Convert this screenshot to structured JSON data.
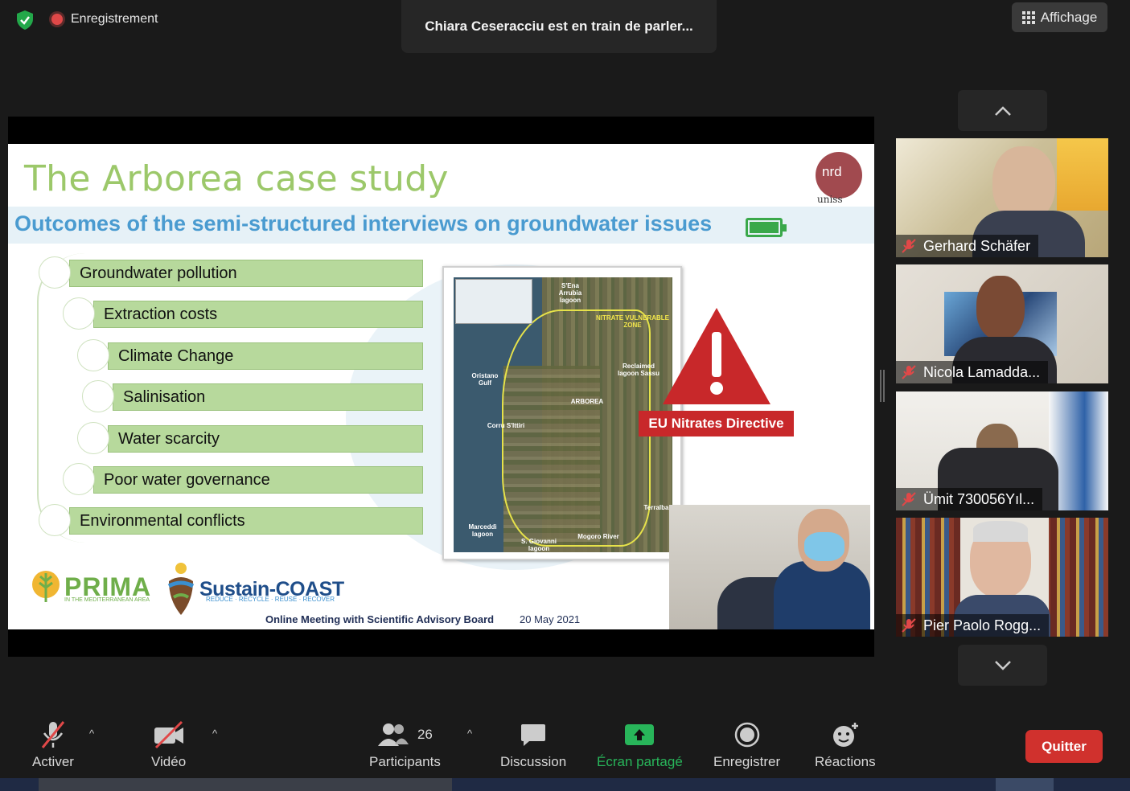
{
  "top_bar": {
    "recording_label": "Enregistrement",
    "speaking_banner": "Chiara Ceseracciu est en train de parler...",
    "view_button": "Affichage"
  },
  "slide": {
    "title": "The Arborea case study",
    "subtitle": "Outcomes of the semi-structured interviews on groundwater issues",
    "logo_nrd": "nrd",
    "logo_uniss": "uniss",
    "items": [
      "Groundwater pollution",
      "Extraction costs",
      "Climate Change",
      "Salinisation",
      "Water scarcity",
      "Poor water governance",
      "Environmental conflicts"
    ],
    "map_labels": {
      "s_ena": "S'Ena Arrubia lagoon",
      "nvz": "NITRATE VULNERABLE ZONE",
      "oristano": "Oristano Gulf",
      "reclaimed": "Reclaimed lagoon Sassu",
      "arborea": "ARBOREA",
      "corru": "Corru S'Ittiri",
      "terralba": "Terralba",
      "marceddi": "Marceddì lagoon",
      "giovanni": "S. Giovanni lagoon",
      "mogoro": "Mogoro River"
    },
    "warning_label": "EU Nitrates Directive",
    "logo_prima": "PRIMA",
    "logo_prima_sub": "IN THE MEDITERRANEAN AREA",
    "logo_sustain": "Sustain-COAST",
    "logo_sustain_sub": "REDUCE · RECYCLE · REUSE · RECOVER",
    "footer_meeting": "Online Meeting with Scientific Advisory Board",
    "footer_date": "20 May 2021",
    "brand_green": "#9cc86a",
    "brand_blue": "#4a9bd0",
    "warning_red": "#c8282a"
  },
  "participants_panel": {
    "tiles": [
      {
        "name": "Gerhard Schäfer",
        "muted": true
      },
      {
        "name": "Nicola Lamadda...",
        "muted": true
      },
      {
        "name": "Ümit 730056Yıl...",
        "muted": true
      },
      {
        "name": "Pier Paolo Rogg...",
        "muted": true
      }
    ]
  },
  "toolbar": {
    "mic_label": "Activer",
    "video_label": "Vidéo",
    "participants_count": "26",
    "participants_label": "Participants",
    "chat_label": "Discussion",
    "share_label": "Écran partagé",
    "record_label": "Enregistrer",
    "reactions_label": "Réactions",
    "quit_label": "Quitter"
  }
}
